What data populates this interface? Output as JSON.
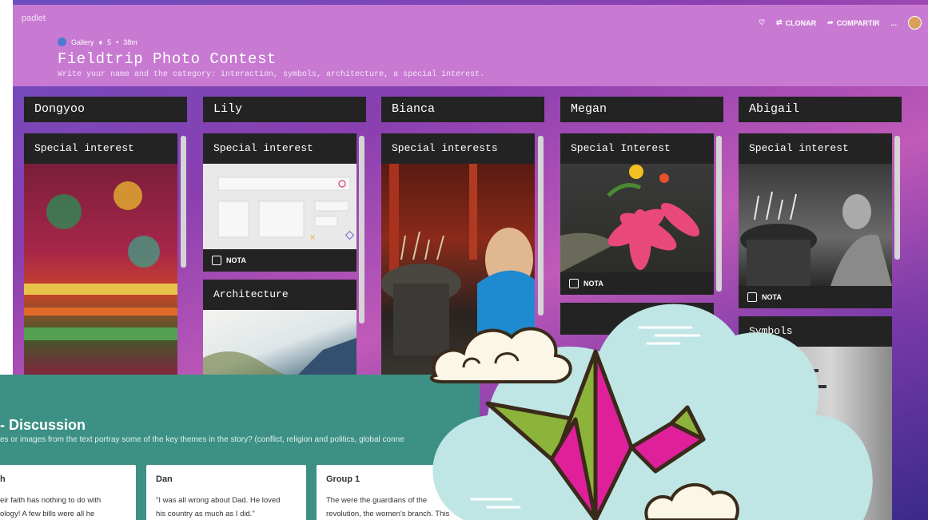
{
  "app": {
    "logo": "padlet"
  },
  "header": {
    "meta": {
      "gallery": "Gallery",
      "count": "5",
      "age": "38m"
    },
    "title": "Fieldtrip Photo Contest",
    "subtitle": "Write your name and the category: interaction, symbols, architecture, a special interest."
  },
  "toolbar": {
    "clone_label": "CLONAR",
    "share_label": "COMPARTIR",
    "more_label": "..."
  },
  "columns": [
    {
      "name": "Dongyoo",
      "cards": [
        {
          "title": "Special interest"
        }
      ]
    },
    {
      "name": "Lily",
      "cards": [
        {
          "title": "Special interest",
          "badge": "NOTA"
        },
        {
          "title": "Architecture"
        }
      ]
    },
    {
      "name": "Bianca",
      "cards": [
        {
          "title": "Special interests"
        }
      ]
    },
    {
      "name": "Megan",
      "cards": [
        {
          "title": "Special Interest",
          "badge": "NOTA"
        }
      ]
    },
    {
      "name": "Abigail",
      "cards": [
        {
          "title": "Special interest",
          "badge": "NOTA"
        },
        {
          "title": "Symbols"
        }
      ]
    }
  ],
  "discussion": {
    "title": "- Discussion",
    "subtitle": "es or images from the text portray some of the key themes in the story? (conflict, religion and politics, global conne",
    "cards": [
      {
        "name": "h",
        "line1": "eir faith has nothing to do with",
        "line2": "ology! A few bills were all he"
      },
      {
        "name": "Dan",
        "line1": "\"I was all wrong about Dad. He loved",
        "line2": "his country as much as I did.\""
      },
      {
        "name": "Group 1",
        "line1": "The were the guardians of the",
        "line2": "revolution, the women's branch. This"
      }
    ]
  },
  "colors": {
    "header": "#c87ad2",
    "card": "#232323",
    "panel": "#3d9184",
    "cloud": "#bfe6e4",
    "crane_green": "#8cb33a",
    "crane_pink": "#e0209a"
  }
}
